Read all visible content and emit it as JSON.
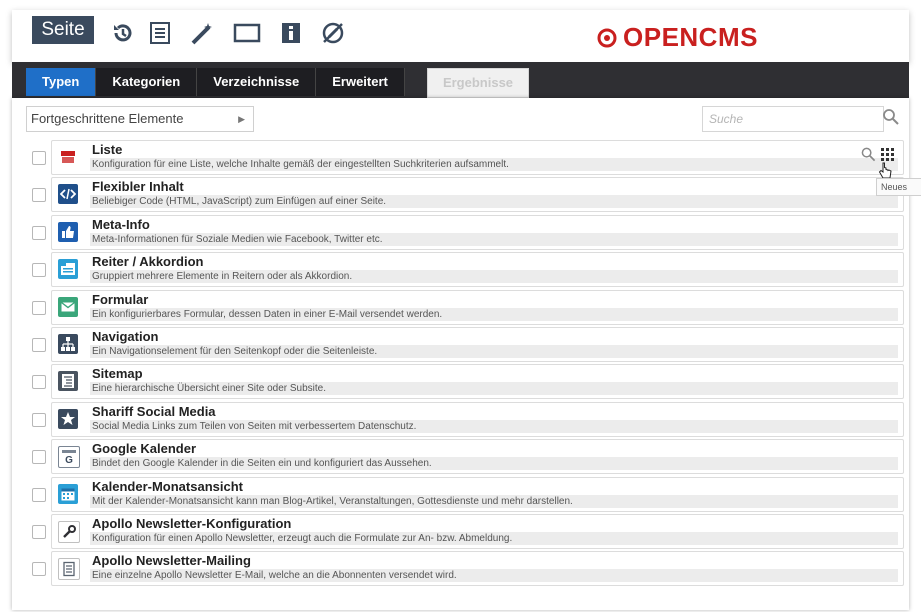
{
  "toolbar": {
    "seite_label": "Seite",
    "brand": "OPENCMS",
    "icons": [
      "history-icon",
      "list-icon",
      "magic-wand-icon",
      "rectangle-icon",
      "info-icon",
      "no-edit-icon"
    ]
  },
  "tabs": [
    {
      "label": "Typen",
      "active": true
    },
    {
      "label": "Kategorien",
      "active": false
    },
    {
      "label": "Verzeichnisse",
      "active": false
    },
    {
      "label": "Erweitert",
      "active": false
    }
  ],
  "results_tab": "Ergebnisse",
  "filter": {
    "type_select": "Fortgeschrittene Elemente",
    "search_placeholder": "Suche"
  },
  "tooltip": "Neues",
  "colors": {
    "accent": "#1f6fc8",
    "brand": "#c9201f",
    "dark": "#2f2f33"
  },
  "items": [
    {
      "title": "Liste",
      "desc": "Konfiguration für eine Liste, welche Inhalte gemäß der eingestellten Suchkriterien aufsammelt.",
      "icon": "list-type-icon"
    },
    {
      "title": "Flexibler Inhalt",
      "desc": "Beliebiger Code (HTML, JavaScript) zum Einfügen auf einer Seite.",
      "icon": "code-icon"
    },
    {
      "title": "Meta-Info",
      "desc": "Meta-Informationen für Soziale Medien wie Facebook, Twitter etc.",
      "icon": "thumbs-up-icon"
    },
    {
      "title": "Reiter / Akkordion",
      "desc": "Gruppiert mehrere Elemente in Reitern oder als Akkordion.",
      "icon": "tabs-icon"
    },
    {
      "title": "Formular",
      "desc": "Ein konfigurierbares Formular, dessen Daten in einer E-Mail versendet werden.",
      "icon": "mail-icon"
    },
    {
      "title": "Navigation",
      "desc": "Ein Navigationselement für den Seitenkopf oder die Seitenleiste.",
      "icon": "sitemap-nav-icon"
    },
    {
      "title": "Sitemap",
      "desc": "Eine hierarchische Übersicht einer Site oder Subsite.",
      "icon": "sitemap-icon"
    },
    {
      "title": "Shariff Social Media",
      "desc": "Social Media Links zum Teilen von Seiten mit verbessertem Datenschutz.",
      "icon": "star-icon"
    },
    {
      "title": "Google Kalender",
      "desc": "Bindet den Google Kalender in die Seiten ein und konfiguriert das Aussehen.",
      "icon": "google-calendar-icon"
    },
    {
      "title": "Kalender-Monatsansicht",
      "desc": "Mit der Kalender-Monatsansicht kann man Blog-Artikel, Veranstaltungen, Gottesdienste und mehr darstellen.",
      "icon": "calendar-icon"
    },
    {
      "title": "Apollo Newsletter-Konfiguration",
      "desc": "Konfiguration für einen Apollo Newsletter, erzeugt auch die Formulate zur An- bzw. Abmeldung.",
      "icon": "wrench-icon"
    },
    {
      "title": "Apollo Newsletter-Mailing",
      "desc": "Eine einzelne Apollo Newsletter E-Mail, welche an die Abonnenten versendet wird.",
      "icon": "document-icon"
    }
  ]
}
